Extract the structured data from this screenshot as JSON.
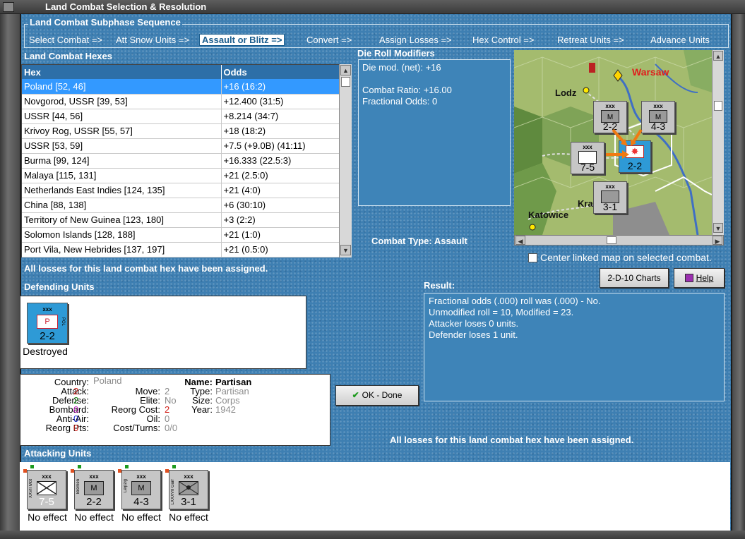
{
  "window": {
    "title": "Land Combat Selection & Resolution"
  },
  "subphase": {
    "title": "Land Combat Subphase Sequence",
    "steps": [
      "Select Combat =>",
      "Att Snow Units =>",
      "Assault or Blitz =>",
      "Convert =>",
      "Assign Losses =>",
      "Hex Control =>",
      "Retreat Units =>",
      "Advance Units"
    ],
    "active_index": 2
  },
  "hexes": {
    "title": "Land Combat Hexes",
    "col_hex": "Hex",
    "col_odds": "Odds",
    "rows": [
      {
        "hex": "Poland [52, 46]",
        "odds": "+16 (16:2)"
      },
      {
        "hex": "Novgorod, USSR [39, 53]",
        "odds": "+12.400 (31:5)"
      },
      {
        "hex": "USSR [44, 56]",
        "odds": "+8.214 (34:7)"
      },
      {
        "hex": "Krivoy Rog, USSR [55, 57]",
        "odds": "+18 (18:2)"
      },
      {
        "hex": "USSR [53, 59]",
        "odds": "+7.5 (+9.0B) (41:11)"
      },
      {
        "hex": "Burma [99, 124]",
        "odds": "+16.333 (22.5:3)"
      },
      {
        "hex": "Malaya [115, 131]",
        "odds": "+21 (2.5:0)"
      },
      {
        "hex": "Netherlands East Indies [124, 135]",
        "odds": "+21 (4:0)"
      },
      {
        "hex": "China [88, 138]",
        "odds": "+6 (30:10)"
      },
      {
        "hex": "Territory of New Guinea [123, 180]",
        "odds": "+3 (2:2)"
      },
      {
        "hex": "Solomon Islands [128, 188]",
        "odds": "+21 (1:0)"
      },
      {
        "hex": "Port Vila, New Hebrides [137, 197]",
        "odds": "+21 (0.5:0)"
      }
    ],
    "selected_index": 0
  },
  "die_roll": {
    "title": "Die Roll Modifiers",
    "lines": [
      "Die mod. (net): +16",
      "",
      "Combat Ratio: +16.00",
      "Fractional Odds: 0"
    ]
  },
  "combat_type": {
    "label": "Combat Type:",
    "value": "Assault"
  },
  "map": {
    "cities": [
      "Warsaw",
      "Lodz",
      "Krakow",
      "Katowice"
    ],
    "center_label": "Center linked map on selected combat.",
    "center_checked": false
  },
  "status": {
    "losses_assigned": "All losses for this land combat hex have been assigned."
  },
  "buttons": {
    "charts": "2-D-10 Charts",
    "help": "Help",
    "ok": "OK - Done"
  },
  "defending": {
    "title": "Defending Units",
    "units": [
      {
        "size": "xxx",
        "type": "P",
        "nation": "POL",
        "strength": "2-2",
        "result": "Destroyed",
        "color": "#2e9ad6"
      }
    ]
  },
  "unit_info": {
    "country_label": "Country:",
    "country": "Poland",
    "attack_label": "Attack:",
    "attack": "2",
    "defense_label": "Defense:",
    "defense": "2",
    "bombard_label": "Bombard:",
    "bombard": "0",
    "antiair_label": "Anti-Air:",
    "antiair": "0",
    "reorg_label": "Reorg Pts:",
    "reorg": "0",
    "move_label": "Move:",
    "move": "2",
    "elite_label": "Elite:",
    "elite": "No",
    "reorgcost_label": "Reorg Cost:",
    "reorgcost": "2",
    "oil_label": "Oil:",
    "oil": "0",
    "costturns_label": "Cost/Turns:",
    "costturns": "0/0",
    "name_label": "Name:",
    "name": "Partisan",
    "type_label": "Type:",
    "type": "Partisan",
    "size_label": "Size:",
    "size": "Corps",
    "year_label": "Year:",
    "year": "1942"
  },
  "result": {
    "title": "Result:",
    "lines": [
      "Fractional odds (.000) roll was (.000)  - No.",
      "Unmodified roll = 10, Modified = 23.",
      "Attacker loses 0 units.",
      "Defender loses 1 unit."
    ]
  },
  "attacking": {
    "title": "Attacking Units",
    "units": [
      {
        "size": "xxx",
        "name": "XXVII Mot",
        "strength": "7-5",
        "result": "No effect",
        "kind": "inf"
      },
      {
        "size": "xxx",
        "name": "Bremen",
        "strength": "2-2",
        "result": "No effect",
        "kind": "mtn"
      },
      {
        "size": "xxx",
        "name": "Leipzig",
        "strength": "4-3",
        "result": "No effect",
        "kind": "mtn"
      },
      {
        "size": "xxx",
        "name": "LXXXVII Garr",
        "strength": "3-1",
        "result": "No effect",
        "kind": "garr"
      }
    ]
  },
  "colors": {
    "panel": "#3e84b8",
    "selection": "#3399ff",
    "attacker_counter": "#c6c6c6",
    "defender_counter": "#2e9ad6"
  }
}
